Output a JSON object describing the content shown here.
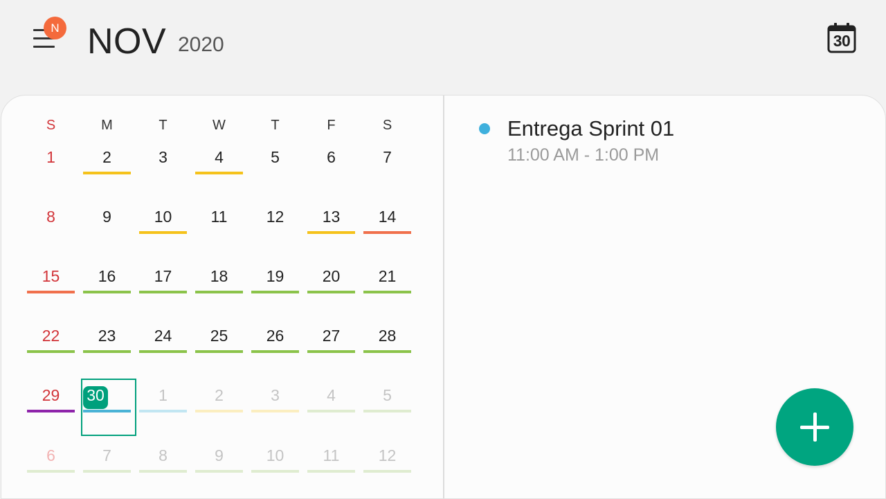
{
  "header": {
    "month": "NOV",
    "year": "2020",
    "notification_badge": "N",
    "today_icon_day": "30",
    "menu_icon": "hamburger-menu-icon",
    "today_icon": "calendar-today-icon"
  },
  "weekdays": [
    "S",
    "M",
    "T",
    "W",
    "T",
    "F",
    "S"
  ],
  "calendar": [
    [
      {
        "label": "1",
        "type": "sun"
      },
      {
        "label": "2",
        "bar": "#f5c21b"
      },
      {
        "label": "3"
      },
      {
        "label": "4",
        "bar": "#f5c21b"
      },
      {
        "label": "5"
      },
      {
        "label": "6"
      },
      {
        "label": "7"
      }
    ],
    [
      {
        "label": "8",
        "type": "sun"
      },
      {
        "label": "9"
      },
      {
        "label": "10",
        "bar": "#f5c21b"
      },
      {
        "label": "11"
      },
      {
        "label": "12"
      },
      {
        "label": "13",
        "bar": "#f5c21b"
      },
      {
        "label": "14",
        "bar": "#f0704c"
      }
    ],
    [
      {
        "label": "15",
        "type": "sun",
        "bar": "#f0704c"
      },
      {
        "label": "16",
        "bar": "#8bc34a"
      },
      {
        "label": "17",
        "bar": "#8bc34a"
      },
      {
        "label": "18",
        "bar": "#8bc34a"
      },
      {
        "label": "19",
        "bar": "#8bc34a"
      },
      {
        "label": "20",
        "bar": "#8bc34a"
      },
      {
        "label": "21",
        "bar": "#8bc34a"
      }
    ],
    [
      {
        "label": "22",
        "type": "sun",
        "bar": "#8bc34a"
      },
      {
        "label": "23",
        "bar": "#8bc34a"
      },
      {
        "label": "24",
        "bar": "#8bc34a"
      },
      {
        "label": "25",
        "bar": "#8bc34a"
      },
      {
        "label": "26",
        "bar": "#8bc34a"
      },
      {
        "label": "27",
        "bar": "#8bc34a"
      },
      {
        "label": "28",
        "bar": "#8bc34a"
      }
    ],
    [
      {
        "label": "29",
        "type": "sun",
        "bar": "#8e24aa"
      },
      {
        "label": "30",
        "today": true,
        "bar": "#4ab3d6"
      },
      {
        "label": "1",
        "type": "other",
        "bar": "#c2e6f2"
      },
      {
        "label": "2",
        "type": "other",
        "bar": "#fbeec0"
      },
      {
        "label": "3",
        "type": "other",
        "bar": "#fbeec0"
      },
      {
        "label": "4",
        "type": "other",
        "bar": "#dfecd0"
      },
      {
        "label": "5",
        "type": "other",
        "bar": "#dfecd0"
      }
    ],
    [
      {
        "label": "6",
        "type": "other sun",
        "bar": "#dfecd0"
      },
      {
        "label": "7",
        "type": "other",
        "bar": "#dfecd0"
      },
      {
        "label": "8",
        "type": "other",
        "bar": "#dfecd0"
      },
      {
        "label": "9",
        "type": "other",
        "bar": "#dfecd0"
      },
      {
        "label": "10",
        "type": "other",
        "bar": "#dfecd0"
      },
      {
        "label": "11",
        "type": "other",
        "bar": "#dfecd0"
      },
      {
        "label": "12",
        "type": "other",
        "bar": "#dfecd0"
      }
    ]
  ],
  "event": {
    "title": "Entrega Sprint 01",
    "time": "11:00 AM - 1:00 PM",
    "color": "#3fb0dd"
  },
  "fab": {
    "icon": "plus-icon",
    "color": "#00a580"
  }
}
